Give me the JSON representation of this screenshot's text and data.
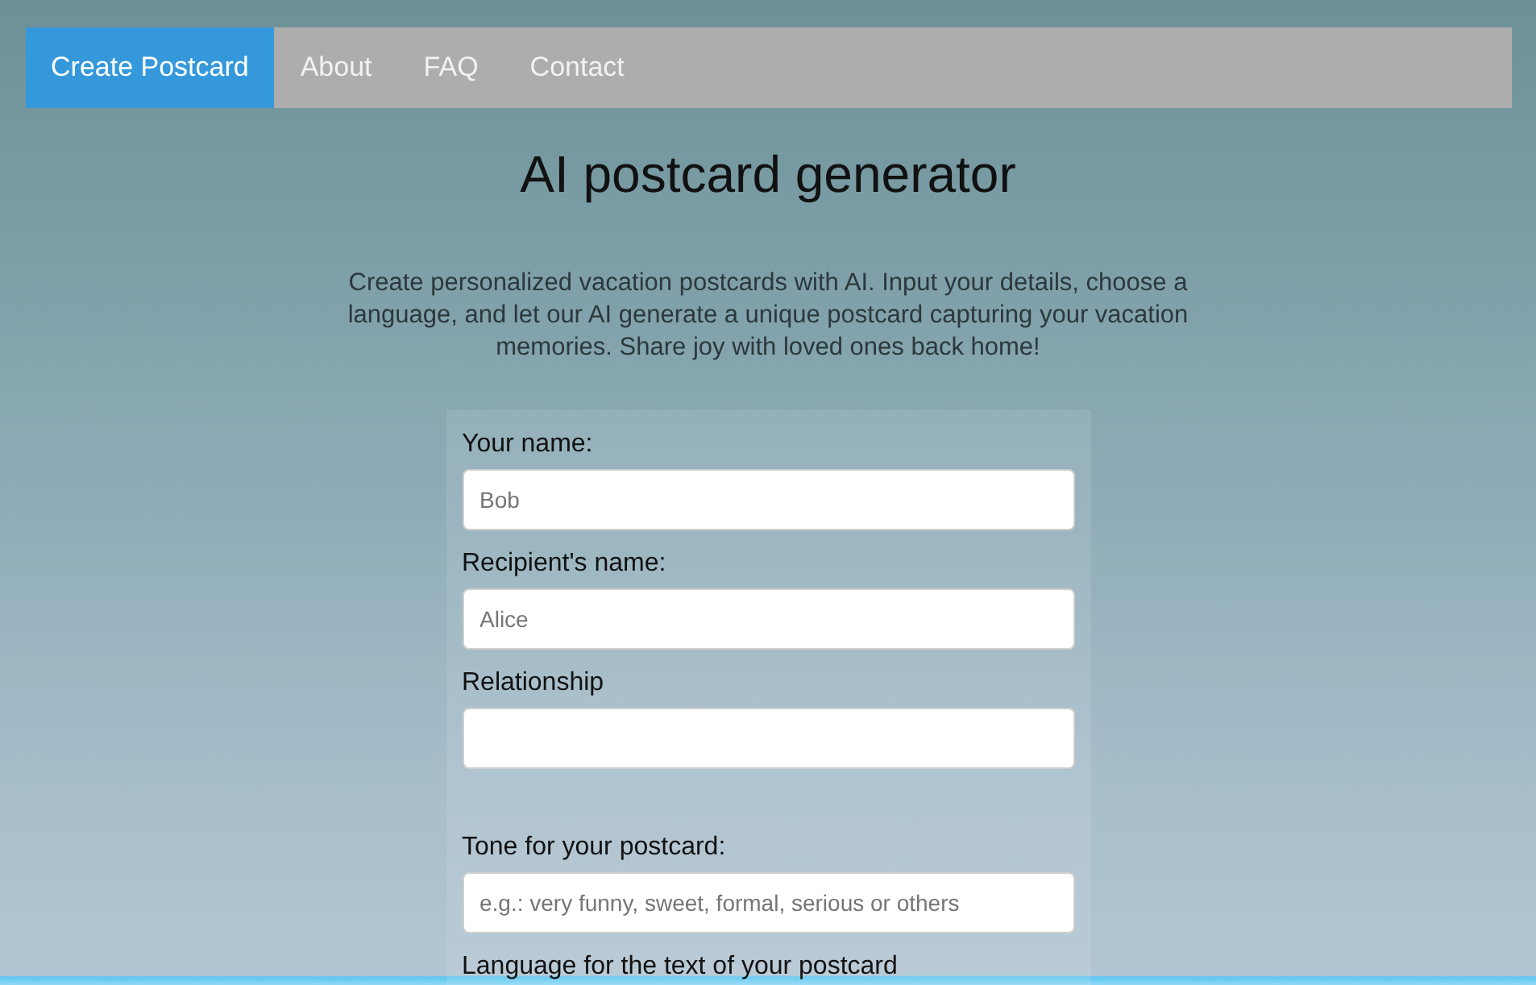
{
  "nav": {
    "items": [
      {
        "label": "Create Postcard",
        "selected": true
      },
      {
        "label": "About",
        "selected": false
      },
      {
        "label": "FAQ",
        "selected": false
      },
      {
        "label": "Contact",
        "selected": false
      }
    ]
  },
  "title": "AI postcard generator",
  "description": "Create personalized vacation postcards with AI. Input your details, choose a language, and let our AI generate a unique postcard capturing your vacation memories. Share joy with loved ones back home!",
  "form": {
    "fields": [
      {
        "kind": "input",
        "label": "Your name:",
        "placeholder": "Bob"
      },
      {
        "kind": "input",
        "label": "Recipient's name:",
        "placeholder": "Alice"
      },
      {
        "kind": "input",
        "label": "Relationship"
      },
      {
        "kind": "input",
        "label": "Tone for your postcard:",
        "placeholder": "e.g.: very funny, sweet, formal, serious or others"
      },
      {
        "kind": "label",
        "label": "Language for the text of your postcard"
      }
    ]
  }
}
